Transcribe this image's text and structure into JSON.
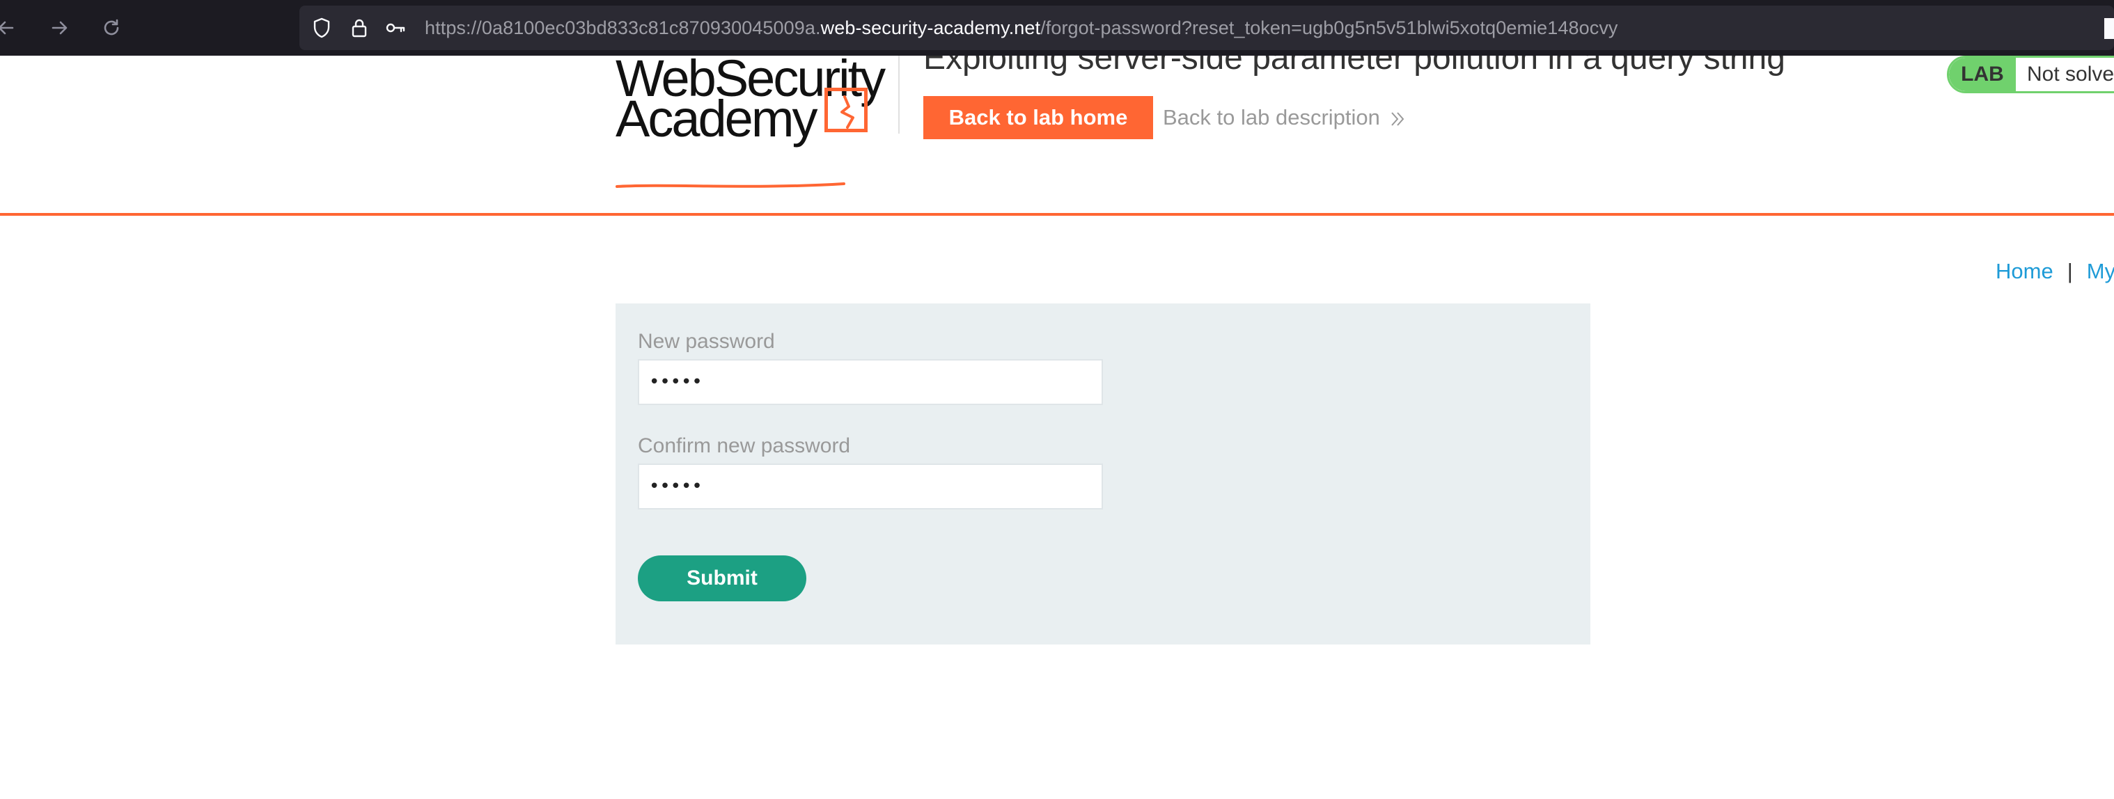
{
  "browser": {
    "url_prefix": "https://0a8100ec03bd833c81c870930045009a.",
    "url_domain": "web-security-academy.net",
    "url_suffix": "/forgot-password?reset_token=ugb0g5n5v51blwi5xotq0emie148ocvy"
  },
  "header": {
    "logo_line1": "WebSecurity",
    "logo_line2": "Academy",
    "lab_title": "Exploiting server-side parameter pollution in a query string",
    "back_home_label": "Back to lab home",
    "back_description_label": "Back to lab description",
    "lab_badge": "LAB",
    "lab_status": "Not solved"
  },
  "nav": {
    "home": "Home",
    "separator": "|",
    "my_account": "My account"
  },
  "form": {
    "new_password_label": "New password",
    "new_password_value": "•••••",
    "confirm_password_label": "Confirm new password",
    "confirm_password_value": "•••••",
    "submit_label": "Submit"
  },
  "colors": {
    "accent_orange": "#ff6633",
    "lab_green": "#70d16d",
    "submit_green": "#1ca083",
    "link_blue": "#1e9bd7"
  },
  "icons": [
    "back-arrow-icon",
    "forward-arrow-icon",
    "reload-icon",
    "shield-icon",
    "lock-icon",
    "key-icon",
    "double-chevron-right-icon"
  ]
}
